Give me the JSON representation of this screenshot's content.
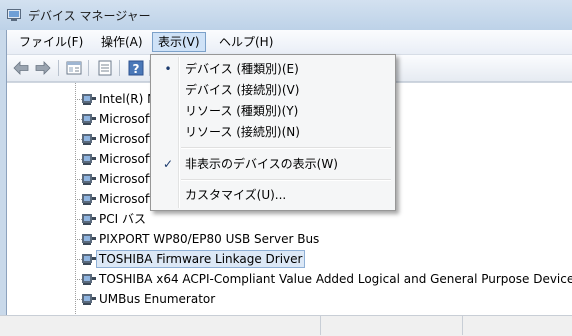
{
  "window": {
    "title": "デバイス マネージャー"
  },
  "menubar": {
    "items": [
      {
        "label": "ファイル(F)"
      },
      {
        "label": "操作(A)"
      },
      {
        "label": "表示(V)"
      },
      {
        "label": "ヘルプ(H)"
      }
    ]
  },
  "toolbar": {
    "icons": [
      "back-arrow-icon",
      "forward-arrow-icon",
      "properties-icon",
      "list-view-icon",
      "help-icon"
    ]
  },
  "tree": {
    "rows": [
      {
        "label": "Intel(R) M"
      },
      {
        "label": "Microsoft"
      },
      {
        "label": "Microsoft"
      },
      {
        "label": "Microsoft"
      },
      {
        "label": "Microsoft"
      },
      {
        "label": "Microsoft"
      },
      {
        "label": "PCI バス"
      },
      {
        "label": "PIXPORT WP80/EP80 USB Server Bus"
      },
      {
        "label": "TOSHIBA Firmware Linkage Driver",
        "selected": true
      },
      {
        "label": "TOSHIBA x64 ACPI-Compliant Value Added Logical and General Purpose Device"
      },
      {
        "label": "UMBus Enumerator"
      }
    ]
  },
  "view_menu": {
    "items": [
      {
        "label": "デバイス (種類別)(E)",
        "mark": "•"
      },
      {
        "label": "デバイス (接続別)(V)",
        "mark": ""
      },
      {
        "label": "リソース (種類別)(Y)",
        "mark": ""
      },
      {
        "label": "リソース (接続別)(N)",
        "mark": ""
      },
      {
        "label": "非表示のデバイスの表示(W)",
        "mark": "✓"
      },
      {
        "label": "カスタマイズ(U)...",
        "mark": ""
      }
    ]
  },
  "colors": {
    "menu_highlight": "#cfe2f7",
    "selection": "#dce8f6",
    "check_mark": "#1b3a6d"
  }
}
